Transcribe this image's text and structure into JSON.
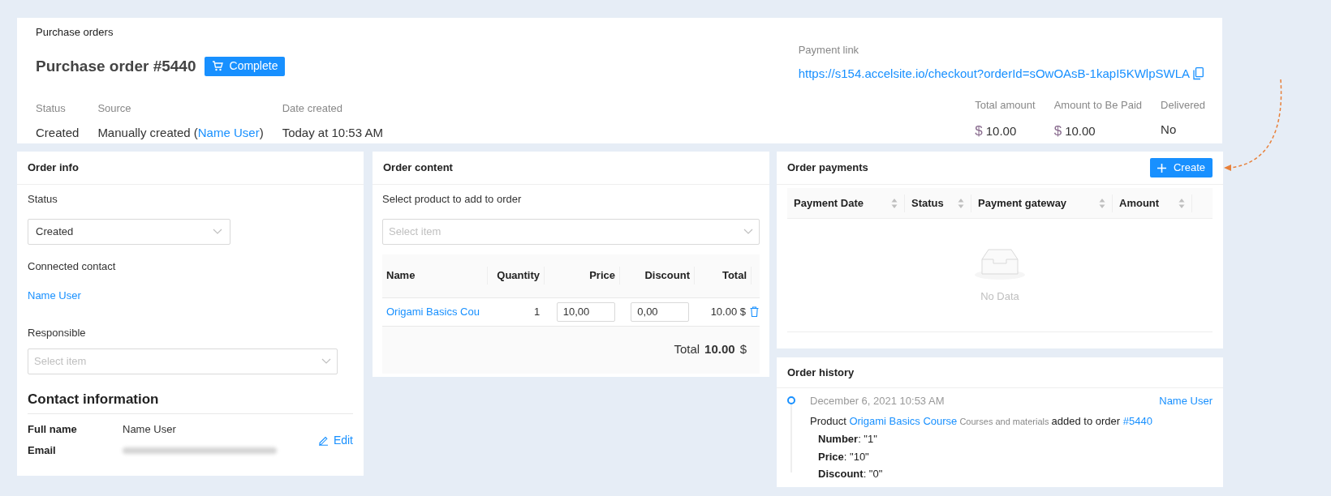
{
  "breadcrumb": "Purchase orders",
  "title": "Purchase order #5440",
  "complete_button": "Complete",
  "meta": [
    {
      "label": "Status",
      "parts": [
        {
          "kind": "text",
          "text": "Created"
        }
      ]
    },
    {
      "label": "Source",
      "parts": [
        {
          "kind": "text",
          "text": "Manually created ("
        },
        {
          "kind": "link",
          "text": "Name User"
        },
        {
          "kind": "text",
          "text": ")"
        }
      ]
    },
    {
      "label": "Date created",
      "parts": [
        {
          "kind": "text",
          "text": "Today at 10:53 AM"
        }
      ]
    }
  ],
  "payment_link": {
    "label": "Payment link",
    "url": "https://s154.accelsite.io/checkout?orderId=sOwOAsB-1kapI5KWlpSWLA"
  },
  "totals": [
    {
      "label": "Total amount",
      "currency": "$",
      "value": "10.00"
    },
    {
      "label": "Amount to Be Paid",
      "currency": "$",
      "value": "10.00"
    },
    {
      "label": "Delivered",
      "value": "No"
    }
  ],
  "order_info": {
    "title": "Order info",
    "status_label": "Status",
    "status_value": "Created",
    "contact_label": "Connected contact",
    "contact_name": "Name User",
    "responsible_label": "Responsible",
    "responsible_placeholder": "Select item",
    "contact_info": {
      "title": "Contact information",
      "edit": "Edit",
      "rows": [
        {
          "kind": "text",
          "label": "Full name",
          "value": "Name User"
        },
        {
          "kind": "blurred",
          "label": "Email"
        }
      ]
    }
  },
  "order_content": {
    "title": "Order content",
    "select_label": "Select product to add to order",
    "select_placeholder": "Select item",
    "columns": [
      "Name",
      "Quantity",
      "Price",
      "Discount",
      "Total"
    ],
    "rows": [
      {
        "name": "Origami Basics Cou",
        "quantity": "1",
        "price": "10,00",
        "discount": "0,00",
        "total": "10.00 $"
      }
    ],
    "total_label": "Total",
    "total_value": "10.00",
    "total_currency": "$"
  },
  "payments": {
    "title": "Order payments",
    "create_button": "Create",
    "columns": [
      "Payment Date",
      "Status",
      "Payment gateway",
      "Amount"
    ],
    "empty_text": "No Data"
  },
  "history": {
    "title": "Order history",
    "entries": [
      {
        "date": "December 6, 2021 10:53 AM",
        "user": "Name User",
        "parts": [
          {
            "kind": "text",
            "text": "Product "
          },
          {
            "kind": "link",
            "text": "Origami Basics Course"
          },
          {
            "kind": "note",
            "text": " Courses and materials "
          },
          {
            "kind": "text",
            "text": "added to order "
          },
          {
            "kind": "link",
            "text": "#5440"
          }
        ],
        "details": [
          "**Number**: \"1\"",
          "**Price**: \"10\"",
          "**Discount**: \"0\""
        ]
      }
    ]
  }
}
